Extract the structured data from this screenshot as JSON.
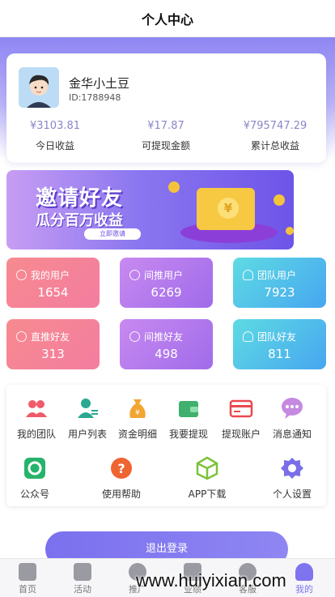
{
  "header": {
    "title": "个人中心"
  },
  "profile": {
    "name": "金华小土豆",
    "id_text": "ID:1788948",
    "stats": [
      {
        "value": "¥3103.81",
        "label": "今日收益"
      },
      {
        "value": "¥17.87",
        "label": "可提现金额"
      },
      {
        "value": "¥795747.29",
        "label": "累计总收益"
      }
    ]
  },
  "banner": {
    "line1": "邀请好友",
    "line2": "瓜分百万收益",
    "button": "立即邀请"
  },
  "tiles": [
    {
      "label": "我的用户",
      "value": "1654",
      "icon": "money-icon"
    },
    {
      "label": "间推用户",
      "value": "6269",
      "icon": "money-icon"
    },
    {
      "label": "团队用户",
      "value": "7923",
      "icon": "users-icon"
    },
    {
      "label": "直推好友",
      "value": "313",
      "icon": "money-icon"
    },
    {
      "label": "间推好友",
      "value": "498",
      "icon": "money-icon"
    },
    {
      "label": "团队好友",
      "value": "811",
      "icon": "users-icon"
    }
  ],
  "menu": [
    {
      "label": "我的团队",
      "icon": "team-icon",
      "color": "#ef5b6a"
    },
    {
      "label": "用户列表",
      "icon": "user-list-icon",
      "color": "#2aa892"
    },
    {
      "label": "资金明细",
      "icon": "money-bag-icon",
      "color": "#f2a531"
    },
    {
      "label": "我要提现",
      "icon": "wallet-icon",
      "color": "#3fb06d"
    },
    {
      "label": "提现账户",
      "icon": "card-icon",
      "color": "#e9494f"
    },
    {
      "label": "消息通知",
      "icon": "chat-icon",
      "color": "#b66cd8"
    },
    {
      "label": "公众号",
      "icon": "wechat-official-icon",
      "color": "#27b36b"
    },
    {
      "label": "使用帮助",
      "icon": "help-icon",
      "color": "#f06432"
    },
    {
      "label": "APP下载",
      "icon": "cube-icon",
      "color": "#7cc23a"
    },
    {
      "label": "个人设置",
      "icon": "settings-icon",
      "color": "#7b6fe8"
    }
  ],
  "logout": {
    "label": "退出登录"
  },
  "tabbar": [
    {
      "label": "首页",
      "icon": "home-icon"
    },
    {
      "label": "活动",
      "icon": "gift-icon"
    },
    {
      "label": "推广",
      "icon": "share-icon"
    },
    {
      "label": "业绩",
      "icon": "grid-icon"
    },
    {
      "label": "客服",
      "icon": "headset-icon"
    },
    {
      "label": "我的",
      "icon": "person-icon"
    }
  ],
  "watermark": "www.huiyixian.com",
  "colors": {
    "accent": "#7f73ef"
  }
}
